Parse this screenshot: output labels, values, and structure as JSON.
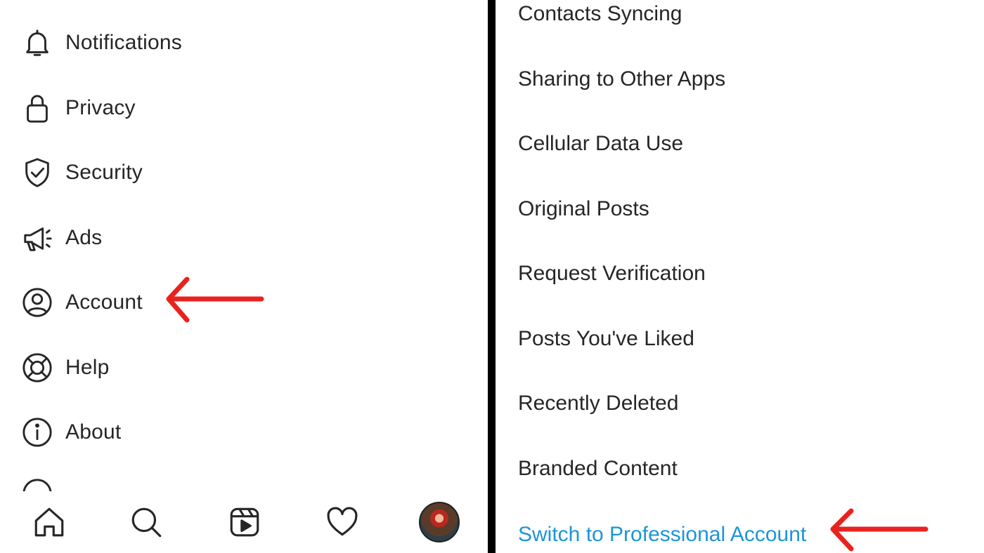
{
  "left_menu": {
    "items": [
      {
        "label": "Notifications",
        "icon": "bell-icon"
      },
      {
        "label": "Privacy",
        "icon": "lock-icon"
      },
      {
        "label": "Security",
        "icon": "shield-check-icon"
      },
      {
        "label": "Ads",
        "icon": "megaphone-icon"
      },
      {
        "label": "Account",
        "icon": "user-circle-icon"
      },
      {
        "label": "Help",
        "icon": "lifebuoy-icon"
      },
      {
        "label": "About",
        "icon": "info-icon"
      }
    ]
  },
  "bottom_nav": {
    "items": [
      "home-icon",
      "search-icon",
      "reels-icon",
      "heart-icon",
      "profile-avatar"
    ]
  },
  "account_settings": {
    "items": [
      {
        "label": "Contacts Syncing"
      },
      {
        "label": "Sharing to Other Apps"
      },
      {
        "label": "Cellular Data Use"
      },
      {
        "label": "Original Posts"
      },
      {
        "label": "Request Verification"
      },
      {
        "label": "Posts You've Liked"
      },
      {
        "label": "Recently Deleted"
      },
      {
        "label": "Branded Content"
      },
      {
        "label": "Switch to Professional Account"
      }
    ]
  },
  "colors": {
    "text": "#262626",
    "link_blue": "#1d95d6",
    "annotation_red": "#e8231f",
    "divider": "#000000"
  },
  "annotations": [
    {
      "type": "red-arrow",
      "points_to": "Account"
    },
    {
      "type": "red-arrow",
      "points_to": "Switch to Professional Account"
    }
  ]
}
